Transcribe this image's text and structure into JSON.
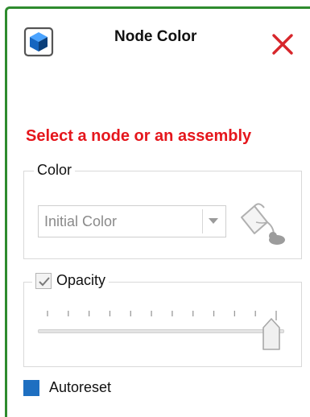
{
  "header": {
    "title": "Node Color",
    "icon": "node-cube-icon",
    "close_icon": "close-icon"
  },
  "warning": {
    "text": "Select a node or an assembly",
    "color": "#e5161c"
  },
  "color_group": {
    "legend": "Color",
    "combo_value": "Initial Color",
    "paint_icon": "paint-bucket-icon"
  },
  "opacity_group": {
    "legend": "Opacity",
    "checked": true,
    "slider_value_fraction": 1.0,
    "tick_count": 12
  },
  "autoreset": {
    "label": "Autoreset",
    "color": "#1e6fc1"
  },
  "colors": {
    "panel_border": "#2e8b2e",
    "accent_blue": "#1e6fc1",
    "close_red": "#d7262b"
  }
}
